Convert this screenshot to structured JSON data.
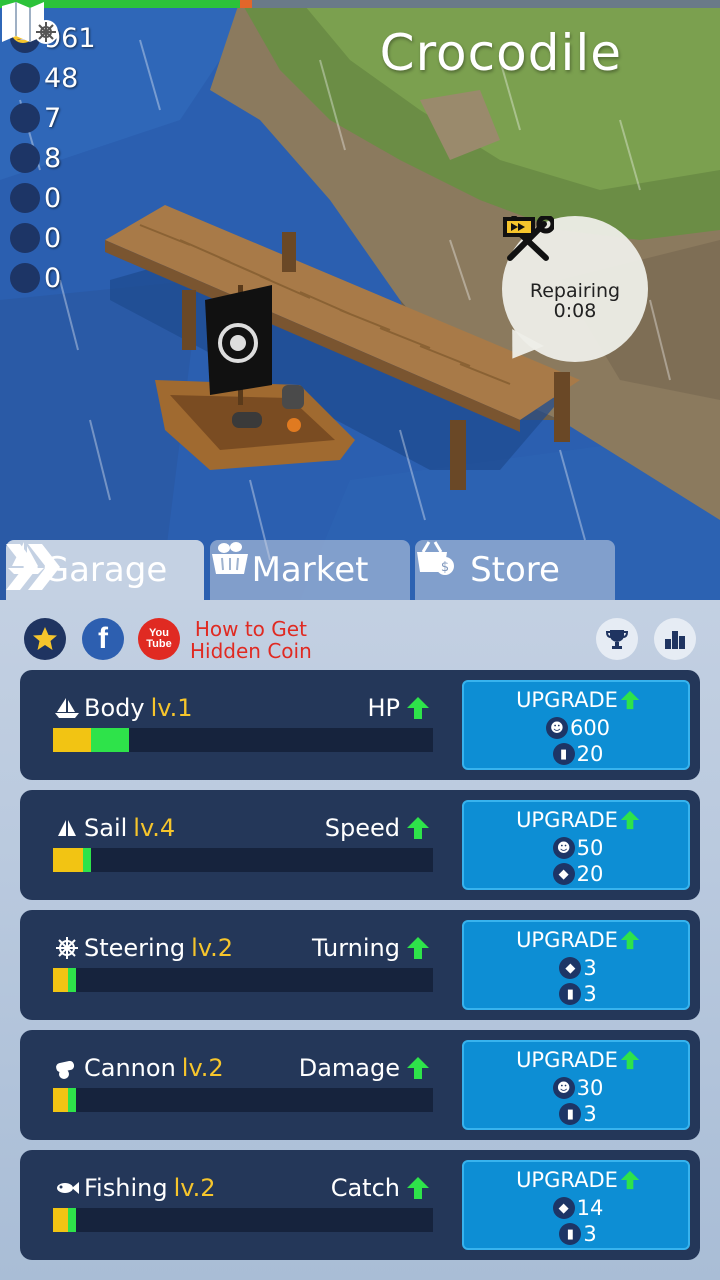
{
  "top_bar": {
    "progress_green": 0.333,
    "progress_orange": 0.017
  },
  "resources": [
    {
      "icon": "coin-icon",
      "value": "961"
    },
    {
      "icon": "fish-icon",
      "value": "48"
    },
    {
      "icon": "wood-icon",
      "value": "7"
    },
    {
      "icon": "stone-icon",
      "value": "8"
    },
    {
      "icon": "silver-icon",
      "value": "0"
    },
    {
      "icon": "gold-icon",
      "value": "0"
    },
    {
      "icon": "gem-icon",
      "value": "0"
    }
  ],
  "island": {
    "name": "Crocodile"
  },
  "repair": {
    "label": "Repairing",
    "time": "0:08"
  },
  "tabs": [
    {
      "label": "Garage",
      "active": true
    },
    {
      "label": "Market",
      "active": false
    },
    {
      "label": "Store",
      "active": false
    }
  ],
  "social": {
    "facebook_glyph": "f",
    "youtube_glyph_top": "You",
    "youtube_glyph_bottom": "Tube",
    "hidden_coin_line1": "How to Get",
    "hidden_coin_line2": "Hidden Coin"
  },
  "upgrades": [
    {
      "name": "Body",
      "level": "lv.1",
      "stat": "HP",
      "bar": {
        "yellow": 0.1,
        "green": 0.1
      },
      "button": "UPGRADE",
      "costs": [
        {
          "icon": "coin-icon",
          "value": "600"
        },
        {
          "icon": "wood-icon",
          "value": "20"
        }
      ]
    },
    {
      "name": "Sail",
      "level": "lv.4",
      "stat": "Speed",
      "bar": {
        "yellow": 0.08,
        "green": 0.02
      },
      "button": "UPGRADE",
      "costs": [
        {
          "icon": "coin-icon",
          "value": "50"
        },
        {
          "icon": "fish-icon",
          "value": "20"
        }
      ]
    },
    {
      "name": "Steering",
      "level": "lv.2",
      "stat": "Turning",
      "bar": {
        "yellow": 0.04,
        "green": 0.02
      },
      "button": "UPGRADE",
      "costs": [
        {
          "icon": "fish-icon",
          "value": "3"
        },
        {
          "icon": "wood-icon",
          "value": "3"
        }
      ]
    },
    {
      "name": "Cannon",
      "level": "lv.2",
      "stat": "Damage",
      "bar": {
        "yellow": 0.04,
        "green": 0.02
      },
      "button": "UPGRADE",
      "costs": [
        {
          "icon": "coin-icon",
          "value": "30"
        },
        {
          "icon": "wood-icon",
          "value": "3"
        }
      ]
    },
    {
      "name": "Fishing",
      "level": "lv.2",
      "stat": "Catch",
      "bar": {
        "yellow": 0.04,
        "green": 0.02
      },
      "button": "UPGRADE",
      "costs": [
        {
          "icon": "fish-icon",
          "value": "14"
        },
        {
          "icon": "wood-icon",
          "value": "3"
        }
      ]
    }
  ],
  "colors": {
    "card_bg": "#243759",
    "button_bg": "#0d8ed4",
    "level_text": "#f6c52c",
    "arrow_green": "#2ee34a",
    "bar_yellow": "#f2c413",
    "bar_green": "#2ee34a",
    "link_red": "#e02a22"
  }
}
